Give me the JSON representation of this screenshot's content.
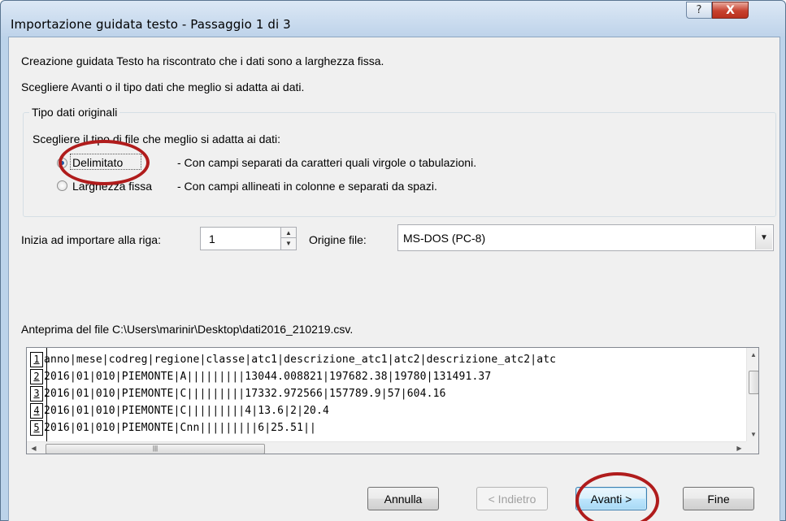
{
  "window": {
    "title": "Importazione guidata testo - Passaggio 1 di 3",
    "help_label": "?",
    "close_label": "X"
  },
  "intro": {
    "line1": "Creazione guidata Testo ha riscontrato che i dati sono a larghezza fissa.",
    "line2": "Scegliere Avanti o il tipo dati che meglio si adatta ai dati."
  },
  "original_type": {
    "legend": "Tipo dati originali",
    "prompt": "Scegliere il tipo di file che meglio si adatta ai dati:",
    "options": [
      {
        "label": "Delimitato",
        "description": "- Con campi separati da caratteri quali virgole o tabulazioni.",
        "selected": true
      },
      {
        "label": "Larghezza fissa",
        "description": "- Con campi allineati in colonne e separati da spazi.",
        "selected": false
      }
    ]
  },
  "import": {
    "start_row_label": "Inizia ad importare alla riga:",
    "start_row_value": "1",
    "origin_label": "Origine file:",
    "origin_value": "MS-DOS (PC-8)"
  },
  "preview": {
    "label": "Anteprima del file C:\\Users\\marinir\\Desktop\\dati2016_210219.csv.",
    "rows": [
      {
        "num": "1",
        "text": "anno|mese|codreg|regione|classe|atc1|descrizione_atc1|atc2|descrizione_atc2|atc"
      },
      {
        "num": "2",
        "text": "2016|01|010|PIEMONTE|A|||||||||13044.008821|197682.38|19780|131491.37"
      },
      {
        "num": "3",
        "text": "2016|01|010|PIEMONTE|C|||||||||17332.972566|157789.9|57|604.16"
      },
      {
        "num": "4",
        "text": "2016|01|010|PIEMONTE|C|||||||||4|13.6|2|20.4"
      },
      {
        "num": "5",
        "text": "2016|01|010|PIEMONTE|Cnn|||||||||6|25.51||"
      }
    ]
  },
  "buttons": {
    "cancel": "Annulla",
    "back": "< Indietro",
    "next": "Avanti >",
    "finish": "Fine"
  },
  "colors": {
    "annotation": "#b01c1c",
    "title_bar": "#bed3ea",
    "default_button_border": "#3c7fb1"
  }
}
